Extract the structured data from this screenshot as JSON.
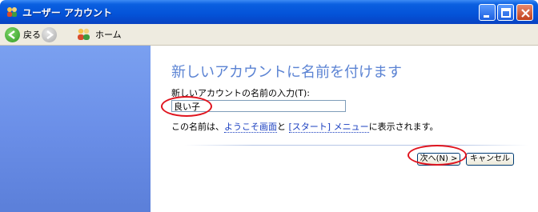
{
  "window": {
    "title": "ユーザー アカウント"
  },
  "toolbar": {
    "back_label": "戻る",
    "home_label": "ホーム"
  },
  "main": {
    "heading": "新しいアカウントに名前を付けます",
    "field_label": "新しいアカウントの名前の入力(T):",
    "name_value": "良い子",
    "hint_prefix": "この名前は、",
    "hint_link1": "ようこそ画面",
    "hint_mid": "と ",
    "hint_link2": "[スタート] メニュー",
    "hint_suffix": "に表示されます。",
    "next_button": "次へ(N) >",
    "cancel_button": "キャンセル"
  },
  "colors": {
    "title_blue": "#0453d8",
    "pane_blue": "#6b8fe8",
    "heading_blue": "#5b83d3",
    "annotation_red": "#e0141e"
  }
}
